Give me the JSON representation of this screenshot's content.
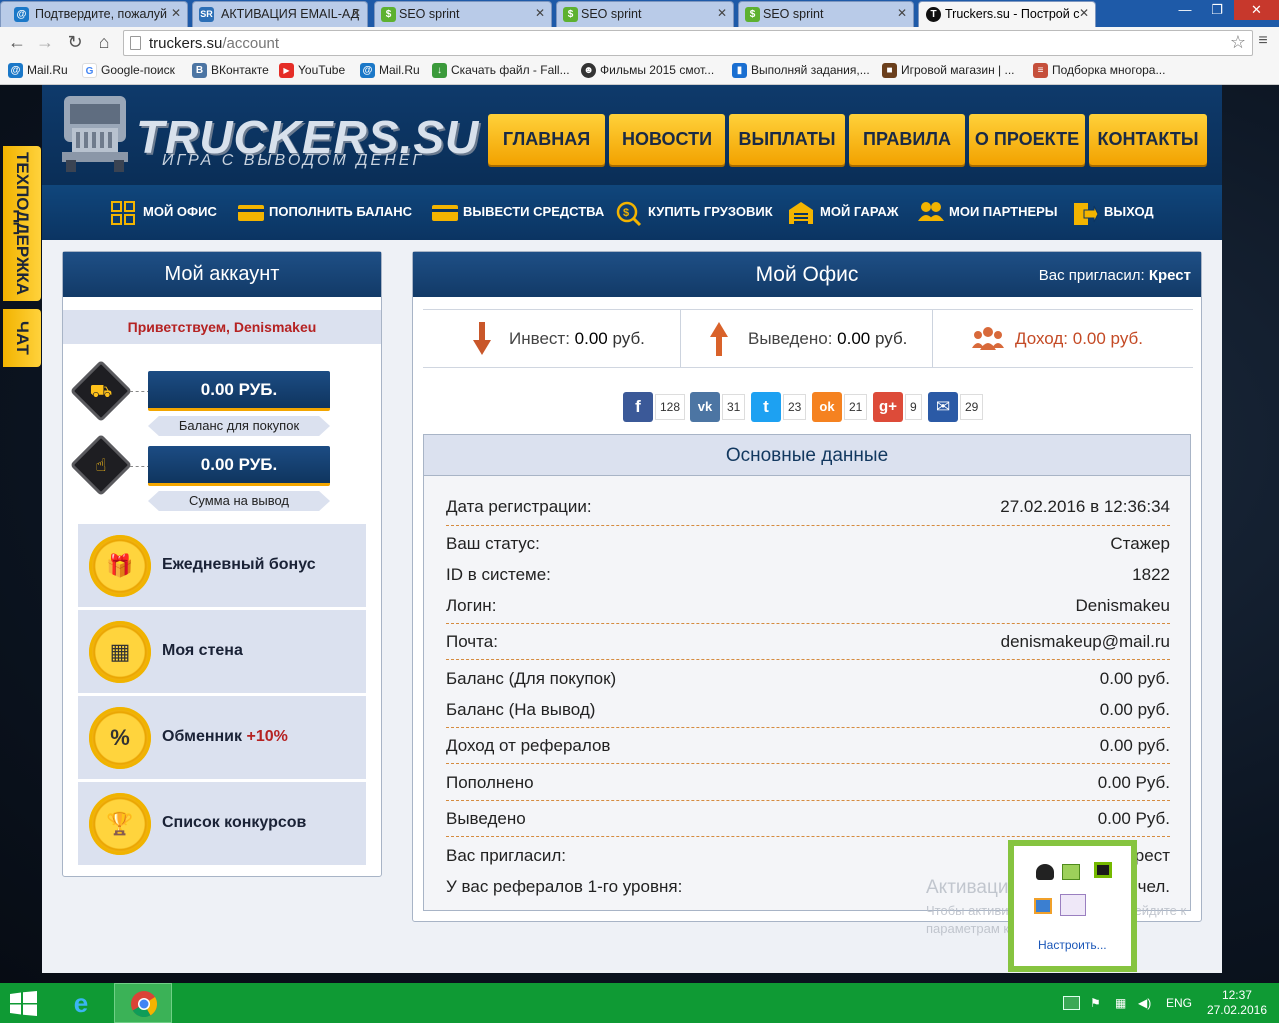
{
  "browser": {
    "tabs": [
      {
        "title": "Подтвердите, пожалуй",
        "icon": "mailru-icon",
        "active": false
      },
      {
        "title": "АКТИВАЦИЯ EMAIL-АД",
        "icon": "sr-icon",
        "active": false
      },
      {
        "title": "SEO sprint",
        "icon": "seosprint-icon",
        "active": false
      },
      {
        "title": "SEO sprint",
        "icon": "seosprint-icon",
        "active": false
      },
      {
        "title": "SEO sprint",
        "icon": "seosprint-icon",
        "active": false
      },
      {
        "title": "Truckers.su - Построй с",
        "icon": "truckers-icon",
        "active": true
      }
    ],
    "url_host": "truckers.su",
    "url_path": "/account",
    "bookmarks": [
      "Mail.Ru",
      "Google-поиск",
      "ВКонтакте",
      "YouTube",
      "Mail.Ru",
      "Скачать файл - Fall...",
      "Фильмы 2015 смот...",
      "Выполняй задания,...",
      "Игровой магазин | ...",
      "Подборка многора..."
    ]
  },
  "site": {
    "logo_text": "TRUCKERS.SU",
    "logo_sub": "ИГРА С ВЫВОДОМ ДЕНЕГ",
    "top_nav": [
      "ГЛАВНАЯ",
      "НОВОСТИ",
      "ВЫПЛАТЫ",
      "ПРАВИЛА",
      "О ПРОЕКТЕ",
      "КОНТАКТЫ"
    ],
    "sub_nav": [
      "МОЙ ОФИС",
      "ПОПОЛНИТЬ БАЛАНС",
      "ВЫВЕСТИ СРЕДСТВА",
      "КУПИТЬ ГРУЗОВИК",
      "МОЙ ГАРАЖ",
      "МОИ ПАРТНЕРЫ",
      "ВЫХОД"
    ],
    "side_tabs": [
      "ТЕХПОДДЕРЖКА",
      "ЧАТ"
    ]
  },
  "account": {
    "title": "Мой аккаунт",
    "greeting": "Приветствуем, Denismakeu",
    "balance_buy": "0.00 РУБ.",
    "balance_buy_label": "Баланс для покупок",
    "balance_withdraw": "0.00 РУБ.",
    "balance_withdraw_label": "Сумма на вывод",
    "menu": [
      {
        "label": "Ежедневный бонус",
        "extra": ""
      },
      {
        "label": "Моя стена",
        "extra": ""
      },
      {
        "label": "Обменник",
        "extra": "+10%"
      },
      {
        "label": "Список конкурсов",
        "extra": ""
      }
    ]
  },
  "office": {
    "title": "Мой Офис",
    "invited_label": "Вас пригласил:",
    "invited_by": "Крест",
    "stats": {
      "invest_label": "Инвест:",
      "invest_value": "0.00",
      "invest_unit": "руб.",
      "withdrawn_label": "Выведено:",
      "withdrawn_value": "0.00",
      "withdrawn_unit": "руб.",
      "income_label": "Доход:",
      "income_value": "0.00 руб."
    },
    "share": [
      {
        "net": "facebook",
        "count": "128",
        "color": "#3b5998",
        "glyph": "f"
      },
      {
        "net": "vk",
        "count": "31",
        "color": "#4c75a3",
        "glyph": "vk"
      },
      {
        "net": "twitter",
        "count": "23",
        "color": "#1da1f2",
        "glyph": "t"
      },
      {
        "net": "odnoklassniki",
        "count": "21",
        "color": "#f58220",
        "glyph": "ok"
      },
      {
        "net": "googleplus",
        "count": "9",
        "color": "#dd4b39",
        "glyph": "g+"
      },
      {
        "net": "email",
        "count": "29",
        "color": "#2b5aa6",
        "glyph": "✉"
      }
    ],
    "data_title": "Основные данные",
    "rows": [
      {
        "k": "Дата регистрации:",
        "v": "27.02.2016 в 12:36:34"
      },
      {
        "k": "Ваш статус:",
        "v": "Стажер"
      },
      {
        "k": "ID в системе:",
        "v": "1822"
      },
      {
        "k": "Логин:",
        "v": "Denismakeu"
      },
      {
        "k": "Почта:",
        "v": "denismakeup@mail.ru"
      },
      {
        "k": "Баланс (Для покупок)",
        "v": "0.00 руб."
      },
      {
        "k": "Баланс (На вывод)",
        "v": "0.00 руб."
      },
      {
        "k": "Доход от рефералов",
        "v": "0.00 руб."
      },
      {
        "k": "Пополнено",
        "v": "0.00 Руб."
      },
      {
        "k": "Выведено",
        "v": "0.00 Руб."
      },
      {
        "k": "Вас пригласил:",
        "v": "Крест"
      },
      {
        "k": "У вас рефералов 1-го уровня:",
        "v": "0 чел."
      }
    ]
  },
  "windows": {
    "activation_title": "Активация Windows",
    "activation_line1": "Чтобы активировать Windows, перейдите к",
    "activation_line2": "параметрам компьютера.",
    "tray_setup": "Настроить...",
    "lang": "ENG",
    "time": "12:37",
    "date": "27.02.2016"
  }
}
